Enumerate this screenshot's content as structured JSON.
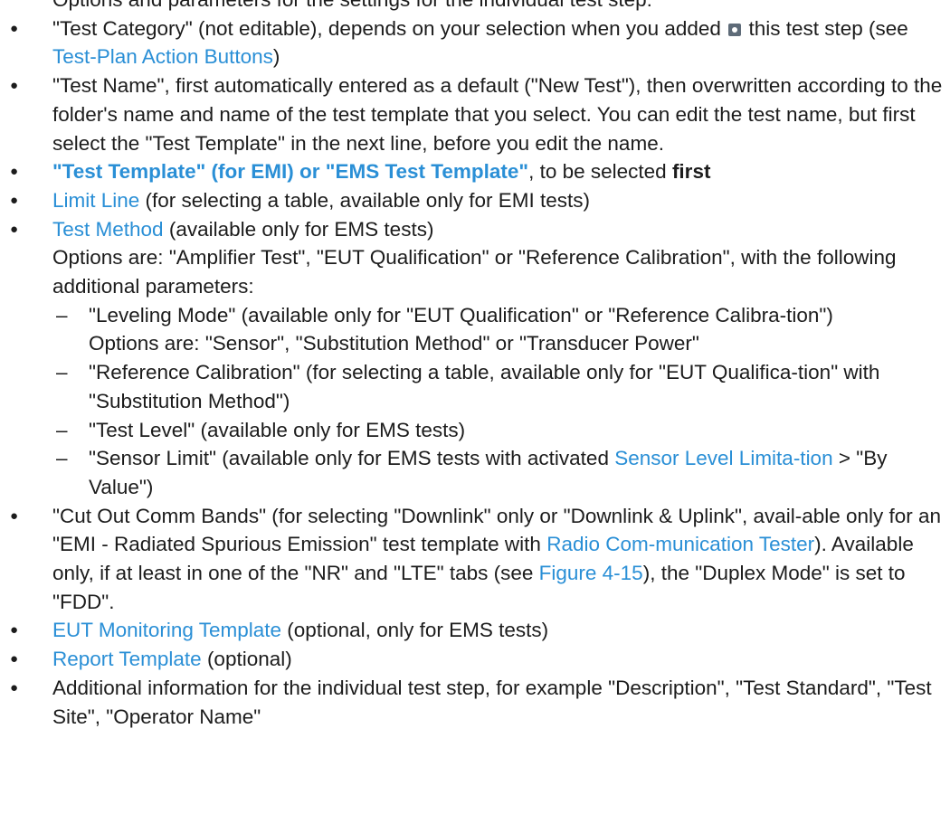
{
  "top_partial": "Options and parameters for the settings for the individual test step:",
  "items": {
    "test_category": {
      "a": "\"Test Category\" (not editable), depends on your selection when you added ",
      "b": " this test step (see ",
      "link": "Test-Plan Action Buttons",
      "c": ")"
    },
    "test_name": "\"Test Name\", first automatically entered as a default (\"New Test\"), then overwritten according to the folder's name and name of the test template that you select. You can edit the test name, but first select the \"Test Template\" in the next line, before you edit the name.",
    "test_template": {
      "bold_link": "\"Test Template\" (for EMI) or \"EMS Test Template\"",
      "a": ", to be selected ",
      "bold": "first"
    },
    "limit_line": {
      "link": "Limit Line",
      "a": " (for selecting a table, available only for EMI tests)"
    },
    "test_method": {
      "link": "Test Method",
      "a": " (available only for EMS tests)",
      "options": "Options are: \"Amplifier Test\", \"EUT Qualification\" or \"Reference Calibration\", with the following additional parameters:",
      "sub": {
        "leveling": "\"Leveling Mode\" (available only for \"EUT Qualification\" or \"Reference Calibra-tion\")",
        "leveling_options": "Options are: \"Sensor\", \"Substitution Method\" or \"Transducer Power\"",
        "ref_cal": "\"Reference Calibration\" (for selecting a table, available only for \"EUT Qualifica-tion\" with \"Substitution Method\")",
        "test_level": "\"Test Level\" (available only for EMS tests)",
        "sensor_limit_a": "\"Sensor Limit\" (available only for EMS tests with activated ",
        "sensor_limit_link": "Sensor Level Limita-tion",
        "sensor_limit_b": " > \"By Value\")"
      }
    },
    "cut_out": {
      "a": "\"Cut Out Comm Bands\" (for selecting \"Downlink\" only or \"Downlink & Uplink\", avail-able only for an \"EMI - Radiated Spurious Emission\" test template with ",
      "link1": "Radio Com-munication Tester",
      "b": "). Available only, if at least in one of the \"NR\" and \"LTE\" tabs (see ",
      "link2": "Figure 4-15",
      "c": "), the \"Duplex Mode\" is set to \"FDD\"."
    },
    "eut_monitoring": {
      "link": "EUT Monitoring Template",
      "a": " (optional, only for EMS tests)"
    },
    "report_template": {
      "link": "Report Template",
      "a": " (optional)"
    },
    "additional": "Additional information for the individual test step, for example \"Description\", \"Test Standard\", \"Test Site\", \"Operator Name\""
  }
}
